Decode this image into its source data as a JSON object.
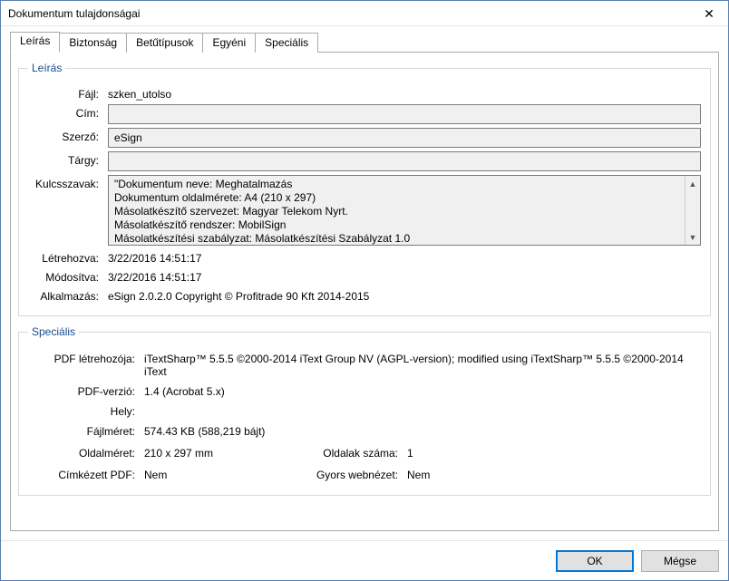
{
  "window": {
    "title": "Dokumentum tulajdonságai"
  },
  "tabs": {
    "description": "Leírás",
    "security": "Biztonság",
    "fonts": "Betűtípusok",
    "custom": "Egyéni",
    "special": "Speciális"
  },
  "group_description": {
    "legend": "Leírás",
    "file_label": "Fájl:",
    "file_value": "szken_utolso",
    "title_label": "Cím:",
    "title_value": "",
    "author_label": "Szerző:",
    "author_value": "eSign",
    "subject_label": "Tárgy:",
    "subject_value": "",
    "keywords_label": "Kulcsszavak:",
    "keywords_value": "\"Dokumentum neve: Meghatalmazás\nDokumentum oldalmérete: A4 (210 x 297)\nMásolatkészítő szervezet: Magyar Telekom Nyrt.\nMásolatkészítő rendszer: MobilSign\nMásolatkészítési szabályzat: Másolatkészítési Szabályzat 1.0",
    "created_label": "Létrehozva:",
    "created_value": "3/22/2016 14:51:17",
    "modified_label": "Módosítva:",
    "modified_value": "3/22/2016 14:51:17",
    "app_label": "Alkalmazás:",
    "app_value": "eSign 2.0.2.0 Copyright © Profitrade 90 Kft 2014-2015"
  },
  "group_special": {
    "legend": "Speciális",
    "producer_label": "PDF létrehozója:",
    "producer_value": "iTextSharp™ 5.5.5 ©2000-2014 iText Group NV (AGPL-version); modified using iTextSharp™ 5.5.5 ©2000-2014 iText",
    "version_label": "PDF-verzió:",
    "version_value": "1.4 (Acrobat 5.x)",
    "location_label": "Hely:",
    "location_value": "",
    "filesize_label": "Fájlméret:",
    "filesize_value": "574.43 KB (588,219 bájt)",
    "pagesize_label": "Oldalméret:",
    "pagesize_value": "210 x 297 mm",
    "pagecount_label": "Oldalak száma:",
    "pagecount_value": "1",
    "tagged_label": "Címkézett PDF:",
    "tagged_value": "Nem",
    "fastweb_label": "Gyors webnézet:",
    "fastweb_value": "Nem"
  },
  "buttons": {
    "ok": "OK",
    "cancel": "Mégse"
  }
}
